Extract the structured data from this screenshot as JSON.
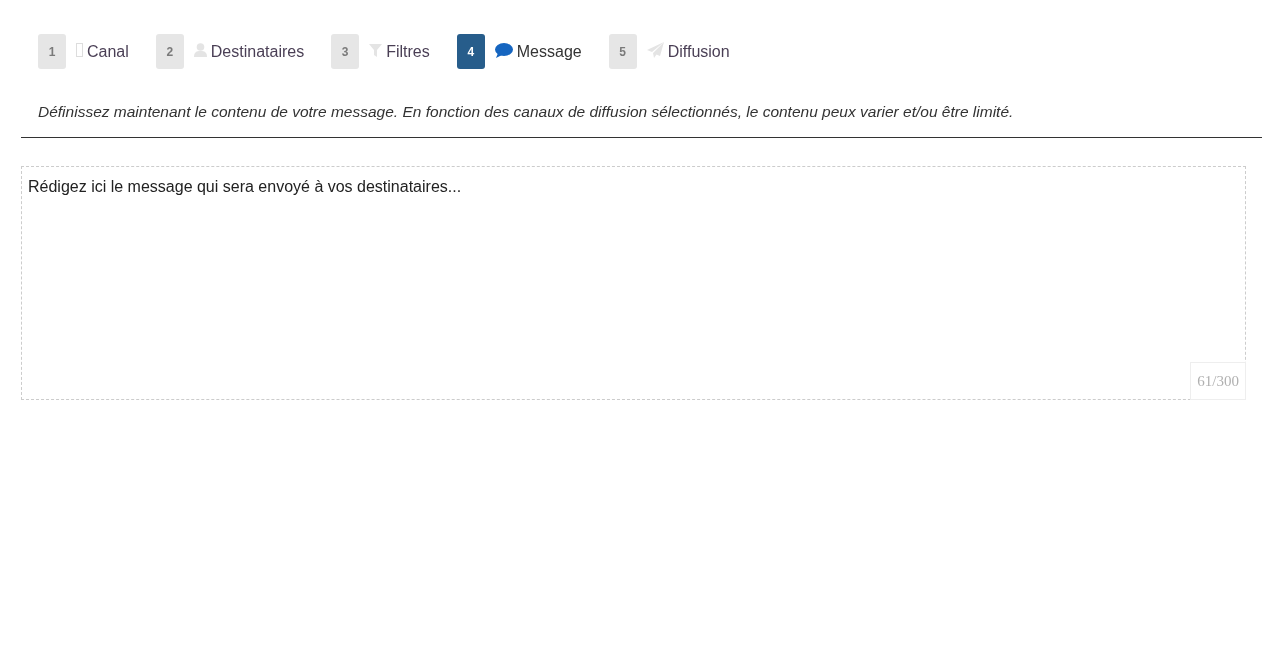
{
  "steps": [
    {
      "number": "1",
      "label": "Canal",
      "selected": false
    },
    {
      "number": "2",
      "label": "Destinataires",
      "selected": false
    },
    {
      "number": "3",
      "label": "Filtres",
      "selected": false
    },
    {
      "number": "4",
      "label": "Message",
      "selected": true
    },
    {
      "number": "5",
      "label": "Diffusion",
      "selected": false
    }
  ],
  "intro": "Définissez maintenant le contenu de votre message. En fonction des canaux de diffusion sélectionnés, le contenu peux varier et/ou être limité.",
  "message": {
    "value": "Rédigez ici le message qui sera envoyé à vos destinataires...",
    "counter": "61/300"
  }
}
